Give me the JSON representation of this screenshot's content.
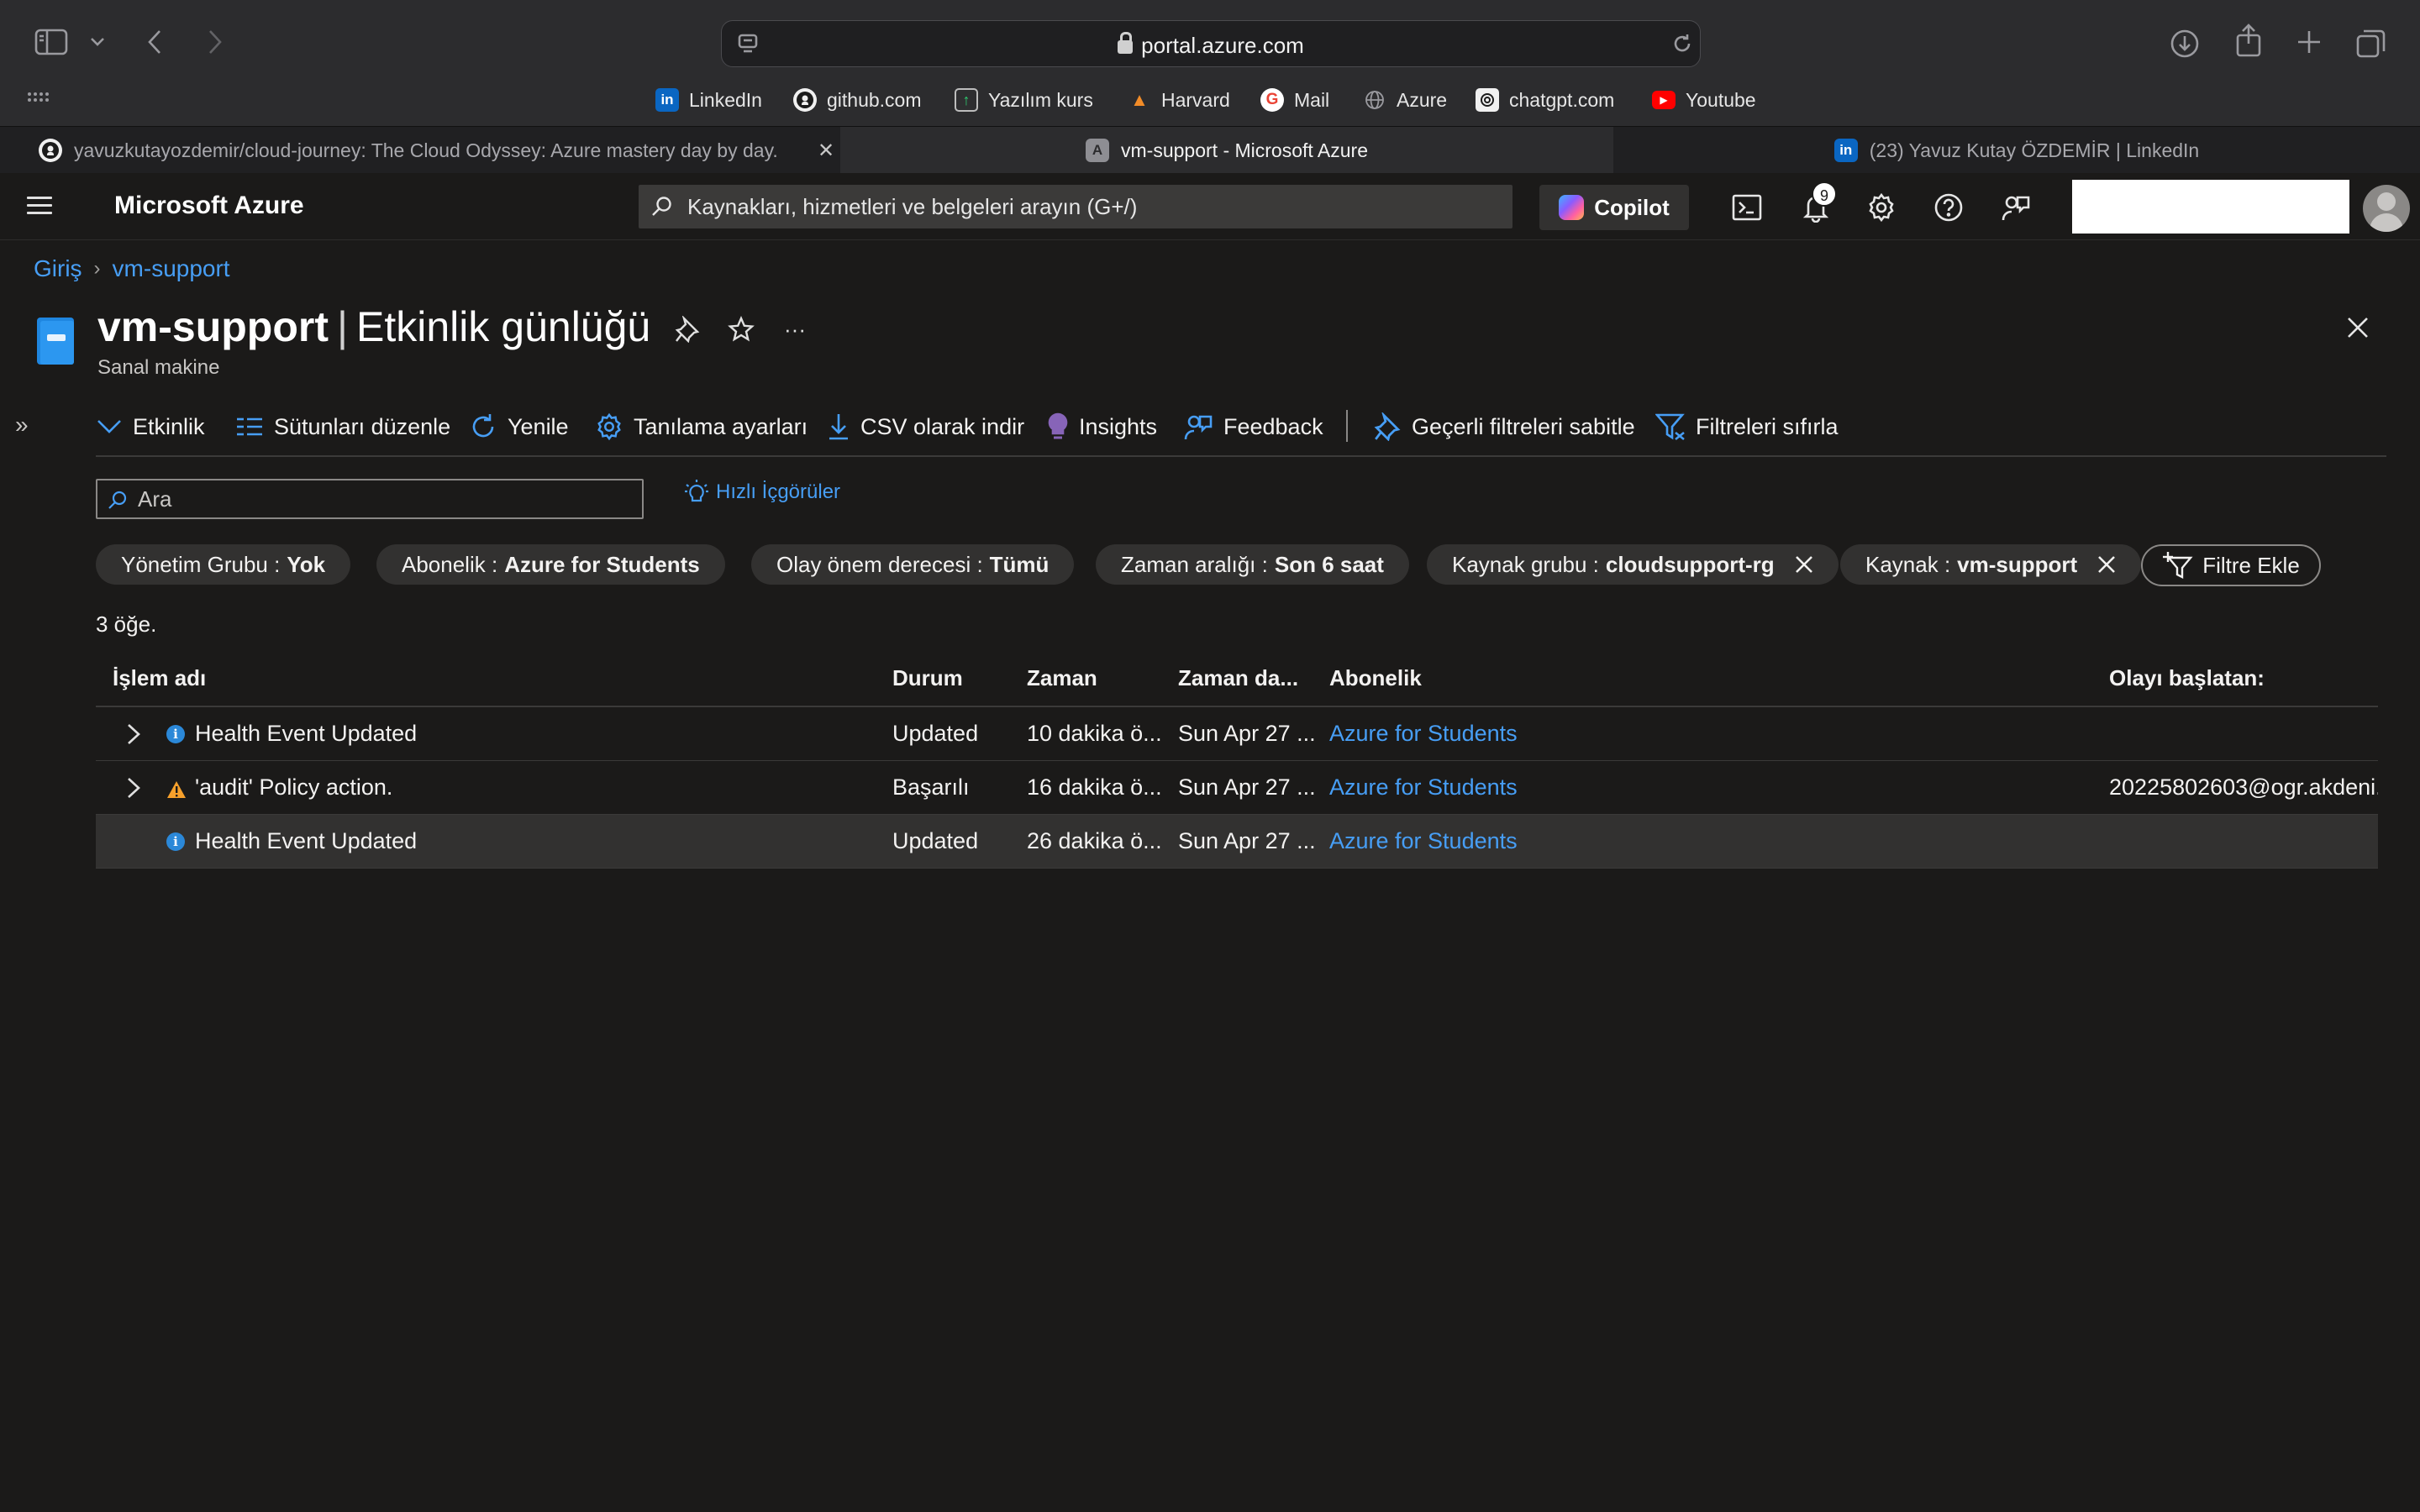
{
  "browser": {
    "address": "portal.azure.com",
    "favorites": [
      {
        "label": "LinkedIn",
        "icon": "linkedin-icon"
      },
      {
        "label": "github.com",
        "icon": "github-icon"
      },
      {
        "label": "Yazılım kurs",
        "icon": "bookmark-icon"
      },
      {
        "label": "Harvard",
        "icon": "rocket-icon"
      },
      {
        "label": "Mail",
        "icon": "google-icon"
      },
      {
        "label": "Azure",
        "icon": "globe-icon"
      },
      {
        "label": "chatgpt.com",
        "icon": "chatgpt-icon"
      },
      {
        "label": "Youtube",
        "icon": "youtube-icon"
      }
    ],
    "tabs": [
      {
        "title": "yavuzkutayozdemir/cloud-journey: The Cloud Odyssey: Azure mastery day by day."
      },
      {
        "title": "vm-support - Microsoft Azure",
        "active": true
      },
      {
        "title": "(23) Yavuz Kutay ÖZDEMİR | LinkedIn"
      }
    ]
  },
  "azure": {
    "brand": "Microsoft Azure",
    "search_placeholder": "Kaynakları, hizmetleri ve belgeleri arayın (G+/)",
    "copilot_label": "Copilot",
    "notification_count": "9"
  },
  "breadcrumb": [
    "Giriş",
    "vm-support"
  ],
  "page": {
    "resource_name": "vm-support",
    "blade_name": "Etkinlik günlüğü",
    "resource_type": "Sanal makine"
  },
  "toolbar": [
    {
      "label": "Etkinlik",
      "icon": "chevron-down-icon"
    },
    {
      "label": "Sütunları düzenle",
      "icon": "columns-icon"
    },
    {
      "label": "Yenile",
      "icon": "refresh-icon"
    },
    {
      "label": "Tanılama ayarları",
      "icon": "gear-icon"
    },
    {
      "label": "CSV olarak indir",
      "icon": "download-icon"
    },
    {
      "label": "Insights",
      "icon": "lightbulb-icon"
    },
    {
      "label": "Feedback",
      "icon": "feedback-icon"
    },
    {
      "label": "Geçerli filtreleri sabitle",
      "icon": "pin-icon"
    },
    {
      "label": "Filtreleri sıfırla",
      "icon": "filter-reset-icon"
    }
  ],
  "search": {
    "placeholder": "Ara"
  },
  "quick_insights": "Hızlı İçgörüler",
  "filters": [
    {
      "key": "Yönetim Grubu :",
      "value": "Yok",
      "removable": false
    },
    {
      "key": "Abonelik :",
      "value": "Azure for Students",
      "removable": false
    },
    {
      "key": "Olay önem derecesi :",
      "value": "Tümü",
      "removable": false
    },
    {
      "key": "Zaman aralığı :",
      "value": "Son 6 saat",
      "removable": false
    },
    {
      "key": "Kaynak grubu :",
      "value": "cloudsupport-rg",
      "removable": true
    },
    {
      "key": "Kaynak :",
      "value": "vm-support",
      "removable": true
    }
  ],
  "add_filter": "Filtre Ekle",
  "item_count": "3 öğe.",
  "table": {
    "columns": [
      "İşlem adı",
      "Durum",
      "Zaman",
      "Zaman da...",
      "Abonelik",
      "Olayı başlatan:"
    ],
    "rows": [
      {
        "operation": "Health Event Updated",
        "severity": "info",
        "status": "Updated",
        "time": "10 dakika ö...",
        "timestamp": "Sun Apr 27 ...",
        "subscription": "Azure for Students",
        "initiated_by": "",
        "expandable": true
      },
      {
        "operation": "'audit' Policy action.",
        "severity": "warning",
        "status": "Başarılı",
        "time": "16 dakika ö...",
        "timestamp": "Sun Apr 27 ...",
        "subscription": "Azure for Students",
        "initiated_by": "20225802603@ogr.akdeni...",
        "expandable": true
      },
      {
        "operation": "Health Event Updated",
        "severity": "info",
        "status": "Updated",
        "time": "26 dakika ö...",
        "timestamp": "Sun Apr 27 ...",
        "subscription": "Azure for Students",
        "initiated_by": "",
        "expandable": false,
        "selected": true
      }
    ]
  },
  "colors": {
    "accent": "#479ef5",
    "background": "#1b1a19",
    "warning": "#f7a02b",
    "info": "#2b88d8"
  }
}
